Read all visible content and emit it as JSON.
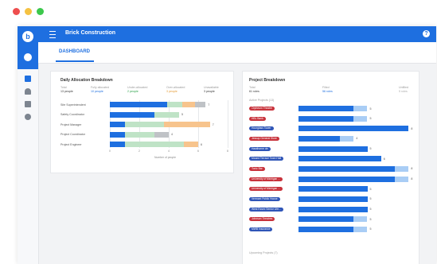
{
  "window": {
    "dots": [
      "#ee4e4e",
      "#f5c242",
      "#3cc84c"
    ]
  },
  "sidebar": {
    "logo_letter": "b"
  },
  "header": {
    "title": "Brick Construction",
    "help_label": "?"
  },
  "nav": {
    "active_tab": "DASHBOARD"
  },
  "daily": {
    "title": "Daily Allocation Breakdown",
    "summary": [
      {
        "label": "Total",
        "value": "13 people",
        "color": "#333333"
      },
      {
        "label": "Fully allocated",
        "value": "10 people",
        "color": "#1e6fe0"
      },
      {
        "label": "Under-allocated",
        "value": "2 people",
        "color": "#2aa148"
      },
      {
        "label": "Over-allocated",
        "value": "3 people",
        "color": "#e59a33"
      },
      {
        "label": "Unavailable",
        "value": "3 people",
        "color": "#333333"
      }
    ],
    "rows": [
      {
        "label": "Site Superintendent",
        "count": "7",
        "segments": [
          {
            "frac": 3.9,
            "color": "#1e6fe0"
          },
          {
            "frac": 1.0,
            "color": "#bfe3c6"
          },
          {
            "frac": 0.9,
            "color": "#f7c48d"
          },
          {
            "frac": 0.7,
            "color": "#bfc2c6"
          }
        ]
      },
      {
        "label": "Safety Coordinator",
        "count": "5",
        "segments": [
          {
            "frac": 3.0,
            "color": "#1e6fe0"
          },
          {
            "frac": 1.7,
            "color": "#bfe3c6"
          }
        ]
      },
      {
        "label": "Project Manager",
        "count": "7",
        "segments": [
          {
            "frac": 1.0,
            "color": "#1e6fe0"
          },
          {
            "frac": 2.7,
            "color": "#bfe3c6"
          },
          {
            "frac": 3.1,
            "color": "#f7c48d"
          }
        ]
      },
      {
        "label": "Project Coordinator",
        "count": "4",
        "segments": [
          {
            "frac": 1.0,
            "color": "#1e6fe0"
          },
          {
            "frac": 2.0,
            "color": "#bfe3c6"
          },
          {
            "frac": 1.0,
            "color": "#bfc2c6"
          }
        ]
      },
      {
        "label": "Project Engineer",
        "count": "6",
        "segments": [
          {
            "frac": 1.0,
            "color": "#1e6fe0"
          },
          {
            "frac": 4.0,
            "color": "#bfe3c6"
          },
          {
            "frac": 1.0,
            "color": "#f7c48d"
          }
        ]
      }
    ],
    "ticks": [
      "0",
      "2",
      "4",
      "6",
      "8"
    ],
    "axis_label": "Number of people"
  },
  "projects": {
    "title": "Project Breakdown",
    "summary": [
      {
        "label": "Total",
        "value": "61 roles",
        "color": "#333333"
      },
      {
        "label": "Filled",
        "value": "56 roles",
        "color": "#1e6fe0"
      },
      {
        "label": "Unfilled",
        "value": "5 roles",
        "color": "#aaaaaa"
      }
    ],
    "active_header": "Active Projects (13)",
    "items": [
      {
        "name": "Orpheum Theatre",
        "color": "#c8323b",
        "filled": 4,
        "unfilled": 1,
        "total": "5"
      },
      {
        "name": "HBL Bank",
        "color": "#c8323b",
        "filled": 4,
        "unfilled": 1,
        "total": "5"
      },
      {
        "name": "Hourglass Tower",
        "color": "#2f55b7",
        "filled": 8,
        "unfilled": 0,
        "total": "8"
      },
      {
        "name": "Jessup General Store",
        "color": "#c8323b",
        "filled": 3,
        "unfilled": 1,
        "total": "4"
      },
      {
        "name": "Hawthorne de",
        "color": "#2f55b7",
        "filled": 5,
        "unfilled": 0,
        "total": "5"
      },
      {
        "name": "Mound Terrace Town Hall",
        "color": "#2f55b7",
        "filled": 6,
        "unfilled": 0,
        "total": "6"
      },
      {
        "name": "Tonic Bar",
        "color": "#c8323b",
        "filled": 7,
        "unfilled": 1,
        "total": "8"
      },
      {
        "name": "University of Michigan ...",
        "color": "#c8323b",
        "filled": 7,
        "unfilled": 1,
        "total": "8"
      },
      {
        "name": "University of Michigan ...",
        "color": "#c8323b",
        "filled": 5,
        "unfilled": 0,
        "total": "5"
      },
      {
        "name": "Vermont Public House",
        "color": "#2f55b7",
        "filled": 5,
        "unfilled": 0,
        "total": "5"
      },
      {
        "name": "West Essex Senior Life...",
        "color": "#2f55b7",
        "filled": 5,
        "unfilled": 0,
        "total": "5"
      },
      {
        "name": "Johnson Theatres",
        "color": "#c8323b",
        "filled": 4,
        "unfilled": 1,
        "total": "5"
      },
      {
        "name": "MWB Insurance",
        "color": "#2f55b7",
        "filled": 4,
        "unfilled": 1,
        "total": "5"
      }
    ],
    "upcoming_header": "Upcoming Projects (7)"
  }
}
